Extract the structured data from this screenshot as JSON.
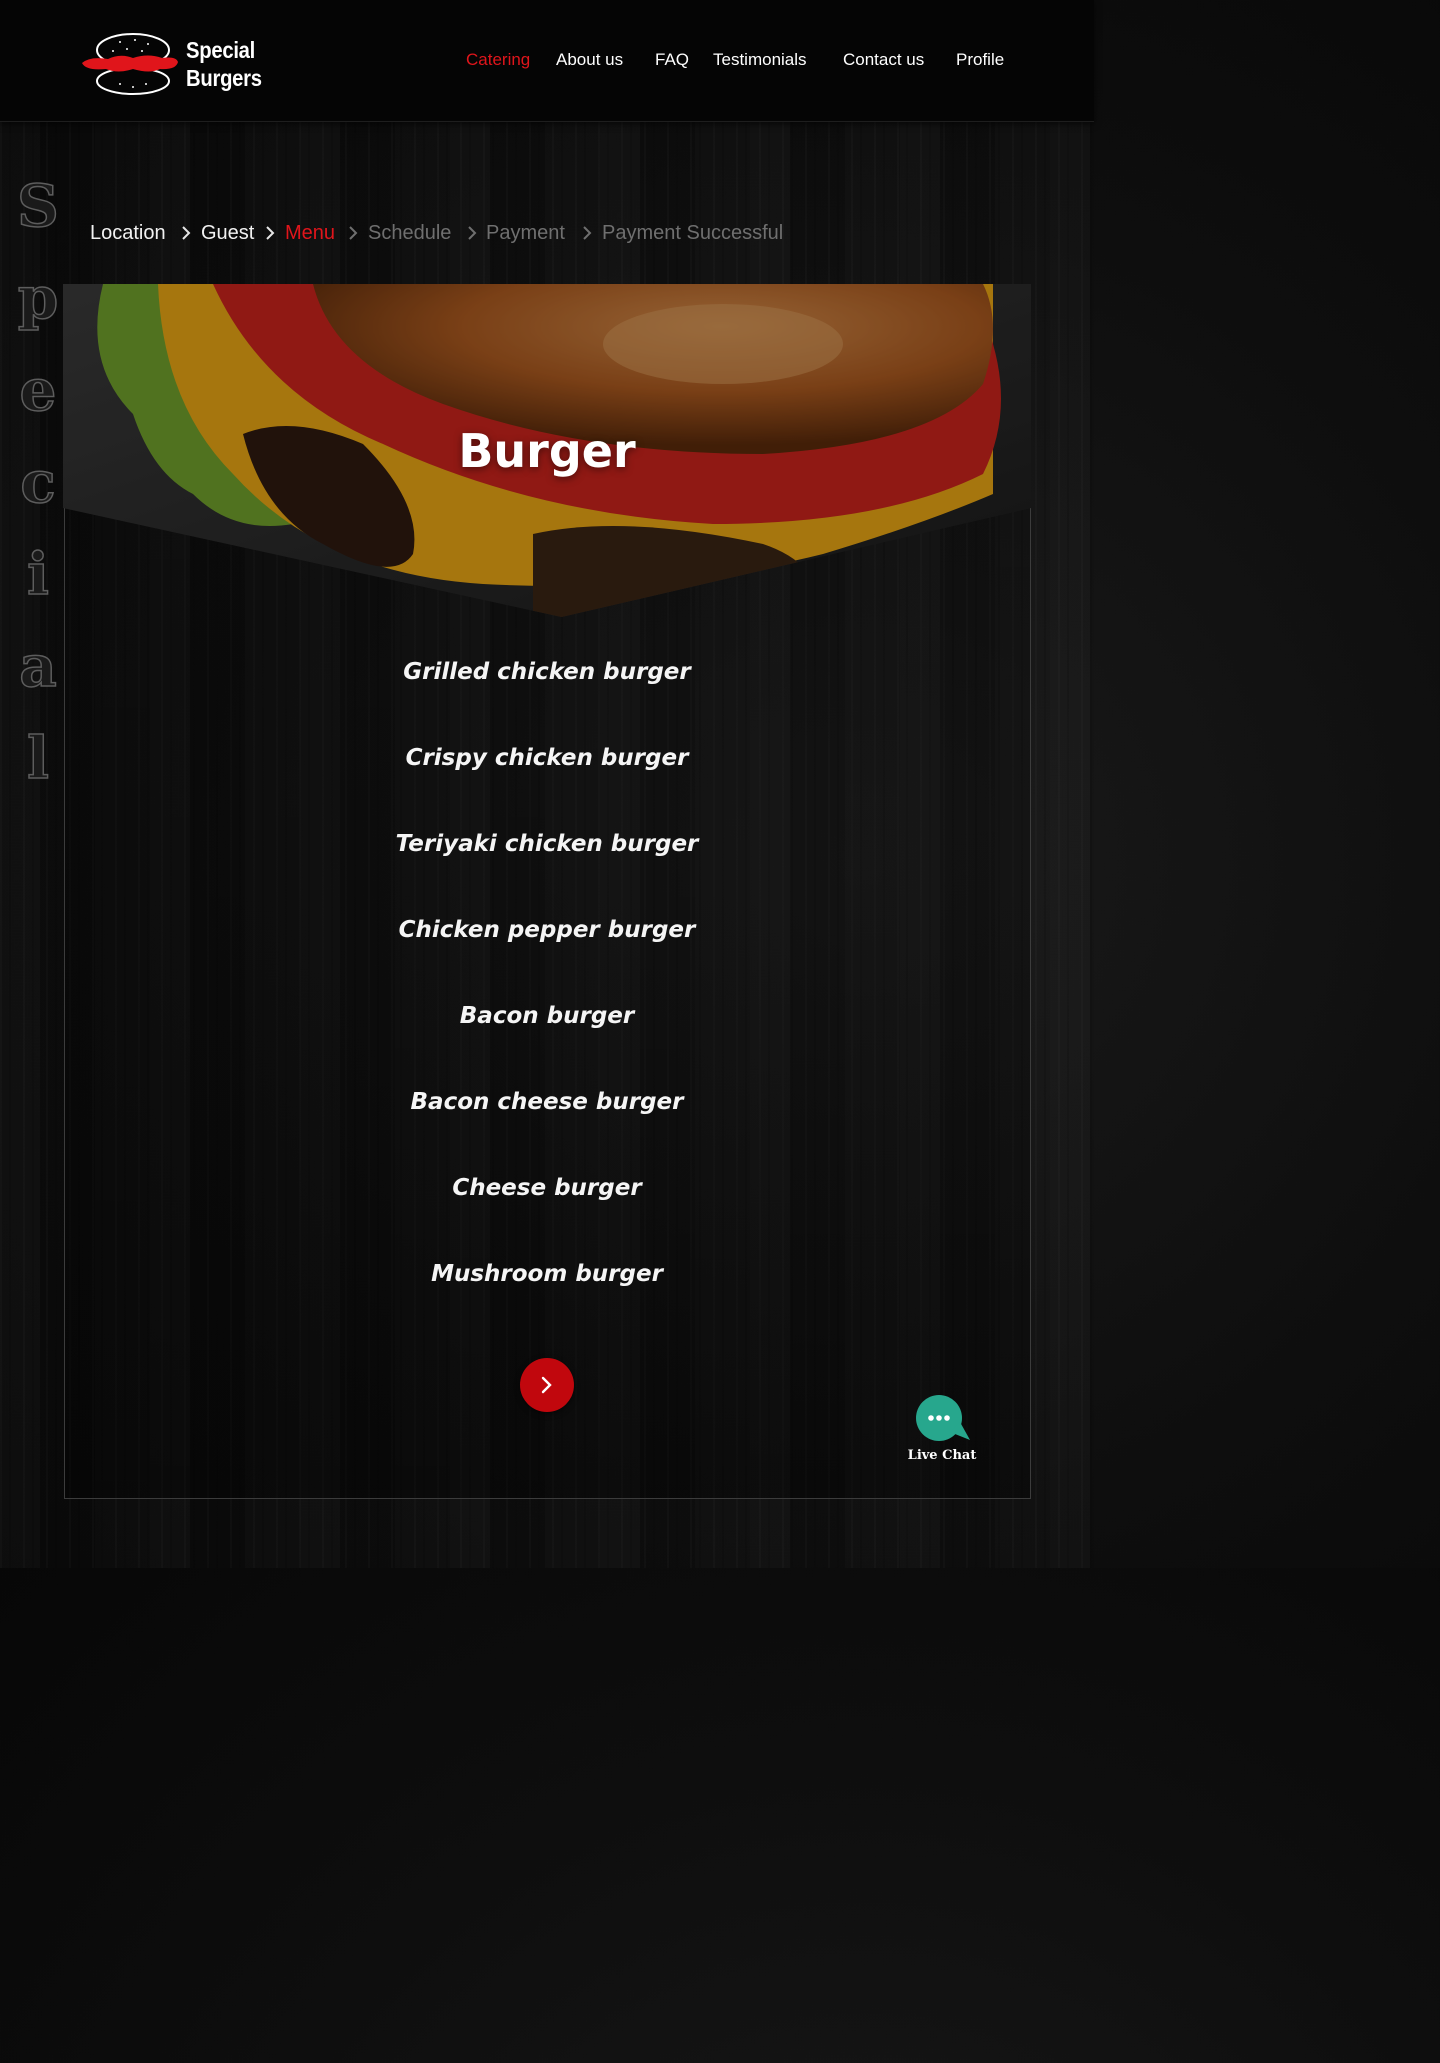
{
  "brand": {
    "line1": "Special",
    "line2": "Burgers"
  },
  "nav": [
    {
      "label": "Catering",
      "active": true
    },
    {
      "label": "About us",
      "active": false
    },
    {
      "label": "FAQ",
      "active": false
    },
    {
      "label": "Testimonials",
      "active": false
    },
    {
      "label": "Contact us",
      "active": false
    },
    {
      "label": "Profile",
      "active": false
    }
  ],
  "side_word": [
    "S",
    "p",
    "e",
    "c",
    "i",
    "a",
    "l"
  ],
  "breadcrumb": [
    {
      "label": "Location",
      "state": "done"
    },
    {
      "label": "Guest",
      "state": "done"
    },
    {
      "label": "Menu",
      "state": "current"
    },
    {
      "label": "Schedule",
      "state": "future"
    },
    {
      "label": "Payment",
      "state": "future"
    },
    {
      "label": "Payment Successful",
      "state": "future"
    }
  ],
  "category": {
    "title": "Burger"
  },
  "menu_items": [
    "Grilled chicken burger",
    "Crispy chicken burger",
    "Teriyaki chicken burger",
    "Chicken pepper burger",
    "Bacon burger",
    "Bacon cheese burger",
    "Cheese burger",
    "Mushroom burger"
  ],
  "next_button": {
    "icon": "chevron-right-icon"
  },
  "live_chat": {
    "label": "Live Chat",
    "icon": "chat-bubble-icon",
    "color": "#27a78d"
  },
  "colors": {
    "accent": "#e0151b",
    "button": "#c1070d",
    "background": "#0b0b0b"
  }
}
